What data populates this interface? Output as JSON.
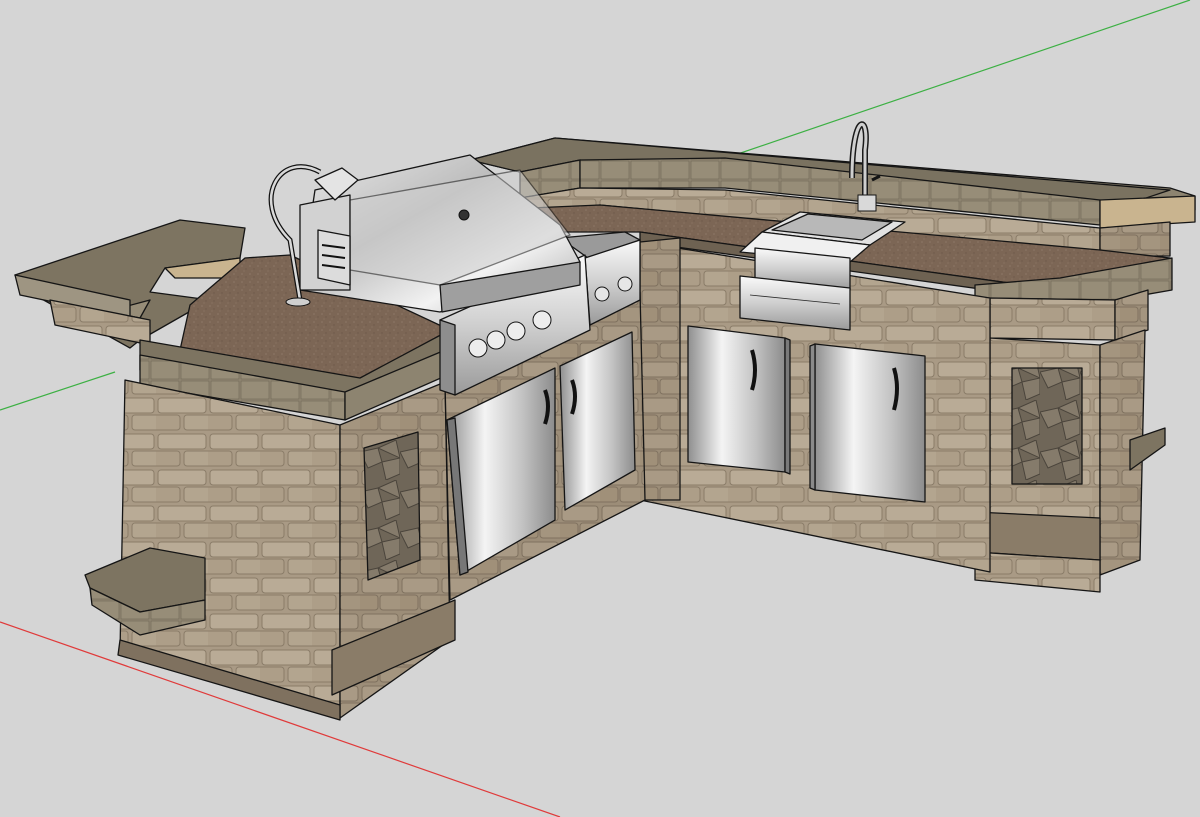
{
  "scene": {
    "description_free": true,
    "colors": {
      "background": "#d5d5d5",
      "axis_red": "#e03a3a",
      "axis_green": "#3cb043",
      "stone_light": "#b8a994",
      "stone_mid": "#a1917c",
      "stone_dark": "#7f715f",
      "cap_top": "#7d7461",
      "counter_top": "#7a6553",
      "steel_light": "#f2f2f2",
      "steel_mid": "#c9c9c9",
      "steel_dark": "#8a8a8a"
    }
  }
}
